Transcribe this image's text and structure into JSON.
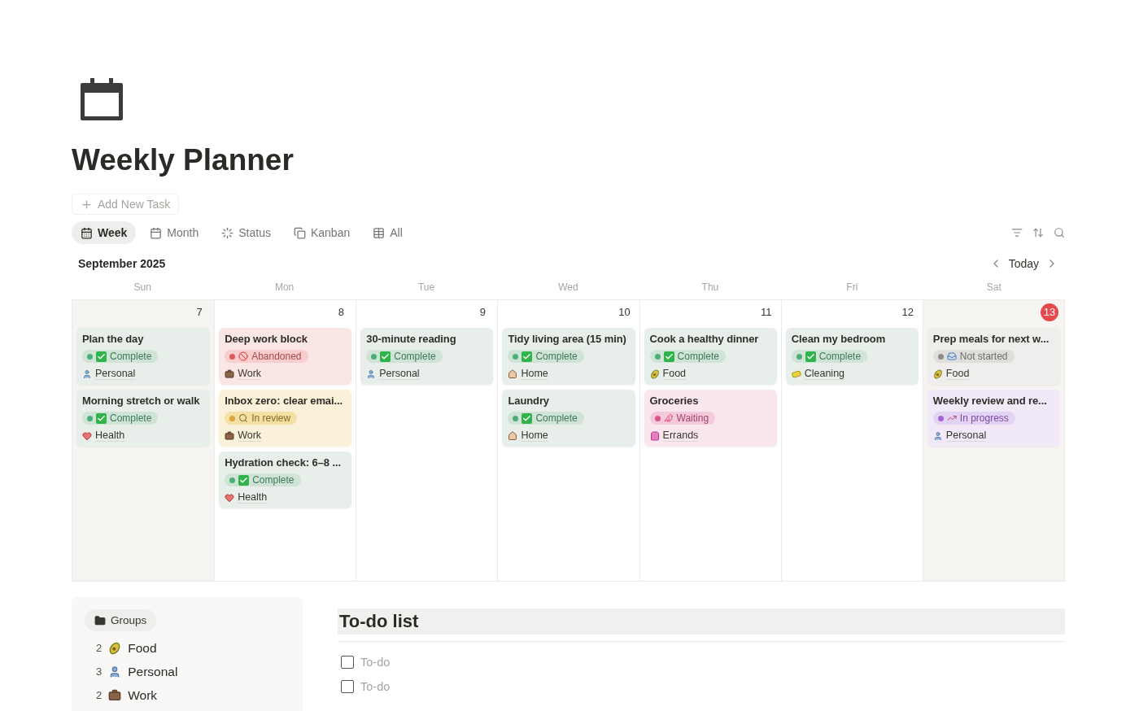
{
  "page": {
    "title": "Weekly Planner",
    "add_button": "Add New Task"
  },
  "views": [
    {
      "label": "Week",
      "kind": "week",
      "selected": true
    },
    {
      "label": "Month",
      "kind": "month",
      "selected": false
    },
    {
      "label": "Status",
      "kind": "status",
      "selected": false
    },
    {
      "label": "Kanban",
      "kind": "kanban",
      "selected": false
    },
    {
      "label": "All",
      "kind": "table",
      "selected": false
    }
  ],
  "calendar": {
    "month": "September 2025",
    "today_button": "Today",
    "weekdays": [
      "Sun",
      "Mon",
      "Tue",
      "Wed",
      "Thu",
      "Fri",
      "Sat"
    ],
    "days": [
      {
        "date": "7",
        "weekend": true,
        "today": false,
        "tasks": [
          {
            "title": "Plan the day",
            "status": {
              "label": "Complete",
              "kind": "complete"
            },
            "category": {
              "label": "Personal",
              "kind": "personal"
            }
          },
          {
            "title": "Morning stretch or walk",
            "status": {
              "label": "Complete",
              "kind": "complete"
            },
            "category": {
              "label": "Health",
              "kind": "health"
            }
          }
        ]
      },
      {
        "date": "8",
        "weekend": false,
        "today": false,
        "tasks": [
          {
            "title": "Deep work block",
            "status": {
              "label": "Abandoned",
              "kind": "abandoned"
            },
            "category": {
              "label": "Work",
              "kind": "work"
            }
          },
          {
            "title": "Inbox zero: clear emai...",
            "status": {
              "label": "In review",
              "kind": "review"
            },
            "category": {
              "label": "Work",
              "kind": "work"
            }
          },
          {
            "title": "Hydration check: 6–8 ...",
            "status": {
              "label": "Complete",
              "kind": "complete"
            },
            "category": {
              "label": "Health",
              "kind": "health"
            }
          }
        ]
      },
      {
        "date": "9",
        "weekend": false,
        "today": false,
        "tasks": [
          {
            "title": "30-minute reading",
            "status": {
              "label": "Complete",
              "kind": "complete"
            },
            "category": {
              "label": "Personal",
              "kind": "personal"
            }
          }
        ]
      },
      {
        "date": "10",
        "weekend": false,
        "today": false,
        "tasks": [
          {
            "title": "Tidy living area (15 min)",
            "status": {
              "label": "Complete",
              "kind": "complete"
            },
            "category": {
              "label": "Home",
              "kind": "home"
            }
          },
          {
            "title": "Laundry",
            "status": {
              "label": "Complete",
              "kind": "complete"
            },
            "category": {
              "label": "Home",
              "kind": "home"
            }
          }
        ]
      },
      {
        "date": "11",
        "weekend": false,
        "today": false,
        "tasks": [
          {
            "title": "Cook a healthy dinner",
            "status": {
              "label": "Complete",
              "kind": "complete"
            },
            "category": {
              "label": "Food",
              "kind": "food"
            }
          },
          {
            "title": "Groceries",
            "status": {
              "label": "Waiting",
              "kind": "waiting"
            },
            "category": {
              "label": "Errands",
              "kind": "errands"
            }
          }
        ]
      },
      {
        "date": "12",
        "weekend": false,
        "today": false,
        "tasks": [
          {
            "title": "Clean my bedroom",
            "status": {
              "label": "Complete",
              "kind": "complete"
            },
            "category": {
              "label": "Cleaning",
              "kind": "cleaning"
            }
          }
        ]
      },
      {
        "date": "13",
        "weekend": true,
        "today": true,
        "tasks": [
          {
            "title": "Prep meals for next w...",
            "status": {
              "label": "Not started",
              "kind": "notstarted"
            },
            "category": {
              "label": "Food",
              "kind": "food"
            }
          },
          {
            "title": "Weekly review and re...",
            "status": {
              "label": "In progress",
              "kind": "progress"
            },
            "category": {
              "label": "Personal",
              "kind": "personal"
            }
          }
        ]
      }
    ]
  },
  "groups": {
    "label": "Groups",
    "items": [
      {
        "count": "2",
        "label": "Food",
        "kind": "food"
      },
      {
        "count": "3",
        "label": "Personal",
        "kind": "personal"
      },
      {
        "count": "2",
        "label": "Work",
        "kind": "work"
      }
    ]
  },
  "todo": {
    "title": "To-do list",
    "items": [
      {
        "label": "To-do",
        "checked": false
      },
      {
        "label": "To-do",
        "checked": false
      }
    ]
  }
}
